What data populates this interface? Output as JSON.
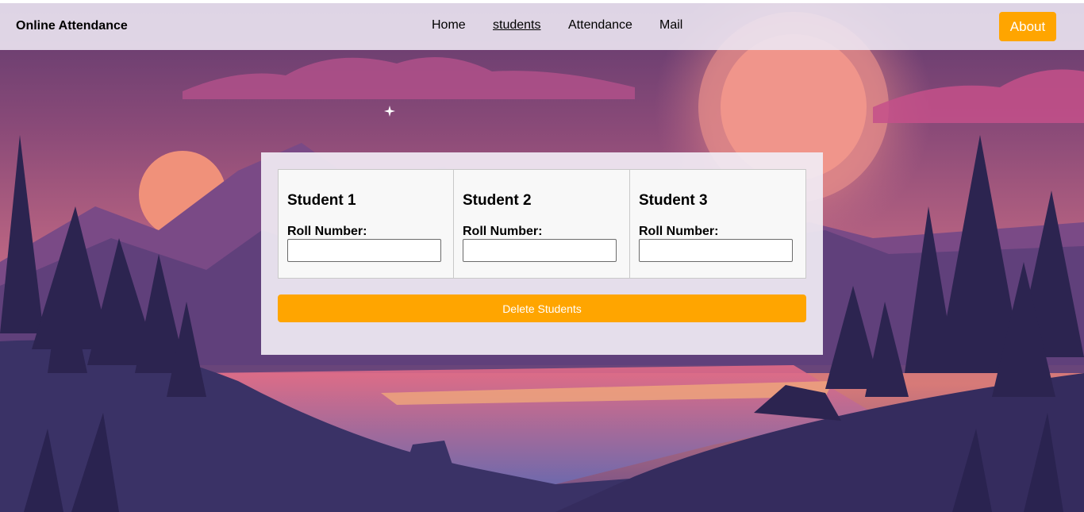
{
  "header": {
    "brand": "Online Attendance",
    "nav": [
      {
        "label": "Home",
        "active": false
      },
      {
        "label": "students",
        "active": true
      },
      {
        "label": "Attendance",
        "active": false
      },
      {
        "label": "Mail",
        "active": false
      }
    ],
    "about_label": "About"
  },
  "students": [
    {
      "title": "Student 1",
      "label": "Roll Number:",
      "value": ""
    },
    {
      "title": "Student 2",
      "label": "Roll Number:",
      "value": ""
    },
    {
      "title": "Student 3",
      "label": "Roll Number:",
      "value": ""
    }
  ],
  "delete_label": "Delete Students",
  "colors": {
    "accent": "#ffa500",
    "navbar": "#ece6f2",
    "panel": "#f1ecf4"
  },
  "icons": [
    "sparkle-icon"
  ]
}
